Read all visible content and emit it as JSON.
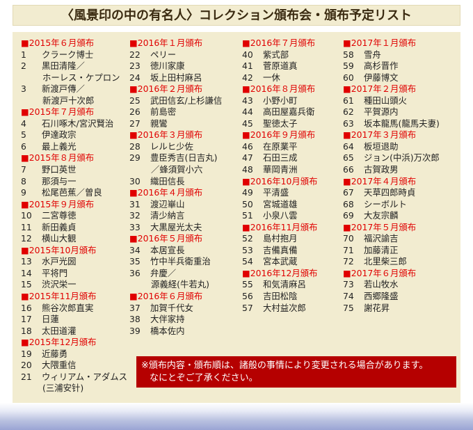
{
  "title": "〈風景印の中の有名人〉コレクション頒布会・頒布予定リスト",
  "columns": [
    [
      {
        "h": "■2015年６月頒布"
      },
      {
        "n": "1",
        "t": "クラーク博士"
      },
      {
        "n": "2",
        "t": "黒田清隆／"
      },
      {
        "n": "",
        "t": "ホーレス・ケプロン"
      },
      {
        "n": "3",
        "t": "新渡戸傳／"
      },
      {
        "n": "",
        "t": "新渡戸十次郎"
      },
      {
        "h": "■2015年７月頒布"
      },
      {
        "n": "4",
        "t": "石川啄木/宮沢賢治"
      },
      {
        "n": "5",
        "t": "伊達政宗"
      },
      {
        "n": "6",
        "t": "最上義光"
      },
      {
        "h": "■2015年８月頒布"
      },
      {
        "n": "7",
        "t": "野口英世"
      },
      {
        "n": "8",
        "t": "那須与一"
      },
      {
        "n": "9",
        "t": "松尾芭蕉／曽良"
      },
      {
        "h": "■2015年９月頒布"
      },
      {
        "n": "10",
        "t": "二宮尊徳"
      },
      {
        "n": "11",
        "t": "新田義貞"
      },
      {
        "n": "12",
        "t": "横山大観"
      },
      {
        "h": "■2015年10月頒布"
      },
      {
        "n": "13",
        "t": "水戸光圀"
      },
      {
        "n": "14",
        "t": "平将門"
      },
      {
        "n": "15",
        "t": "渋沢栄一"
      },
      {
        "h": "■2015年11月頒布"
      },
      {
        "n": "16",
        "t": "熊谷次郎直実"
      },
      {
        "n": "17",
        "t": "日蓮"
      },
      {
        "n": "18",
        "t": "太田道灌"
      },
      {
        "h": "■2015年12月頒布"
      },
      {
        "n": "19",
        "t": "近藤勇"
      },
      {
        "n": "20",
        "t": "大隈重信"
      },
      {
        "n": "21",
        "t": "ウィリアム・アダムス"
      },
      {
        "n": "",
        "t": "(三浦安针)"
      }
    ],
    [
      {
        "h": "■2016年１月頒布"
      },
      {
        "n": "22",
        "t": "ペリー"
      },
      {
        "n": "23",
        "t": "徳川家康"
      },
      {
        "n": "24",
        "t": "坂上田村麻呂"
      },
      {
        "h": "■2016年２月頒布"
      },
      {
        "n": "25",
        "t": "武田信玄/上杉謙信"
      },
      {
        "n": "26",
        "t": "前島密"
      },
      {
        "n": "27",
        "t": "親鸞"
      },
      {
        "h": "■2016年３月頒布"
      },
      {
        "n": "28",
        "t": "レルヒ少佐"
      },
      {
        "n": "29",
        "t": "豊臣秀吉(日吉丸)"
      },
      {
        "n": "",
        "t": "／蜂須賀小六"
      },
      {
        "n": "30",
        "t": "織田信長"
      },
      {
        "h": "■2016年４月頒布"
      },
      {
        "n": "31",
        "t": "渡辺崋山"
      },
      {
        "n": "32",
        "t": "清少納言"
      },
      {
        "n": "33",
        "t": "大黒屋光太夫"
      },
      {
        "h": "■2016年５月頒布"
      },
      {
        "n": "34",
        "t": "本居宣長"
      },
      {
        "n": "35",
        "t": "竹中半兵衛重治"
      },
      {
        "n": "36",
        "t": "弁慶／"
      },
      {
        "n": "",
        "t": "源義経(牛若丸)"
      },
      {
        "h": "■2016年６月頒布"
      },
      {
        "n": "37",
        "t": "加賀千代女"
      },
      {
        "n": "38",
        "t": "大伴家持"
      },
      {
        "n": "39",
        "t": "橋本佐内"
      }
    ],
    [
      {
        "h": "■2016年７月頒布"
      },
      {
        "n": "40",
        "t": "紫式部"
      },
      {
        "n": "41",
        "t": "菅原道真"
      },
      {
        "n": "42",
        "t": "一休"
      },
      {
        "h": "■2016年８月頒布"
      },
      {
        "n": "43",
        "t": "小野小町"
      },
      {
        "n": "44",
        "t": "高田屋嘉兵衛"
      },
      {
        "n": "45",
        "t": "聖徳太子"
      },
      {
        "h": "■2016年９月頒布"
      },
      {
        "n": "46",
        "t": "在原業平"
      },
      {
        "n": "47",
        "t": "石田三成"
      },
      {
        "n": "48",
        "t": "華岡青洲"
      },
      {
        "h": "■2016年10月頒布"
      },
      {
        "n": "49",
        "t": "平清盛"
      },
      {
        "n": "50",
        "t": "宮城道雄"
      },
      {
        "n": "51",
        "t": "小泉八雲"
      },
      {
        "h": "■2016年11月頒布"
      },
      {
        "n": "52",
        "t": "島村抱月"
      },
      {
        "n": "53",
        "t": "吉備真備"
      },
      {
        "n": "54",
        "t": "宮本武蔵"
      },
      {
        "h": "■2016年12月頒布"
      },
      {
        "n": "55",
        "t": "和気清麻呂"
      },
      {
        "n": "56",
        "t": "吉田松陰"
      },
      {
        "n": "57",
        "t": "大村益次郎"
      }
    ],
    [
      {
        "h": "■2017年１月頒布"
      },
      {
        "n": "58",
        "t": "雪舟"
      },
      {
        "n": "59",
        "t": "高杉晋作"
      },
      {
        "n": "60",
        "t": "伊藤博文"
      },
      {
        "h": "■2017年２月頒布"
      },
      {
        "n": "61",
        "t": "種田山頭火"
      },
      {
        "n": "62",
        "t": "平賀源内"
      },
      {
        "n": "63",
        "t": "坂本龍馬(龍馬夫妻)"
      },
      {
        "h": "■2017年３月頒布"
      },
      {
        "n": "64",
        "t": "板垣退助"
      },
      {
        "n": "65",
        "t": "ジョン(中浜)万次郎"
      },
      {
        "n": "66",
        "t": "古賀政男"
      },
      {
        "h": "■2017年４月頒布"
      },
      {
        "n": "67",
        "t": "天草四郎時貞"
      },
      {
        "n": "68",
        "t": "シーボルト"
      },
      {
        "n": "69",
        "t": "大友宗麟"
      },
      {
        "h": "■2017年５月頒布"
      },
      {
        "n": "70",
        "t": "福沢諭吉"
      },
      {
        "n": "71",
        "t": "加藤清正"
      },
      {
        "n": "72",
        "t": "北里柴三郎"
      },
      {
        "h": "■2017年６月頒布"
      },
      {
        "n": "73",
        "t": "若山牧水"
      },
      {
        "n": "74",
        "t": "西郷隆盛"
      },
      {
        "n": "75",
        "t": "謝花昇"
      }
    ]
  ],
  "notice": {
    "line1": "※頒布内容・頒布順は、諸般の事情により変更される場合があります。",
    "line2": "なにとぞご了承ください。"
  }
}
